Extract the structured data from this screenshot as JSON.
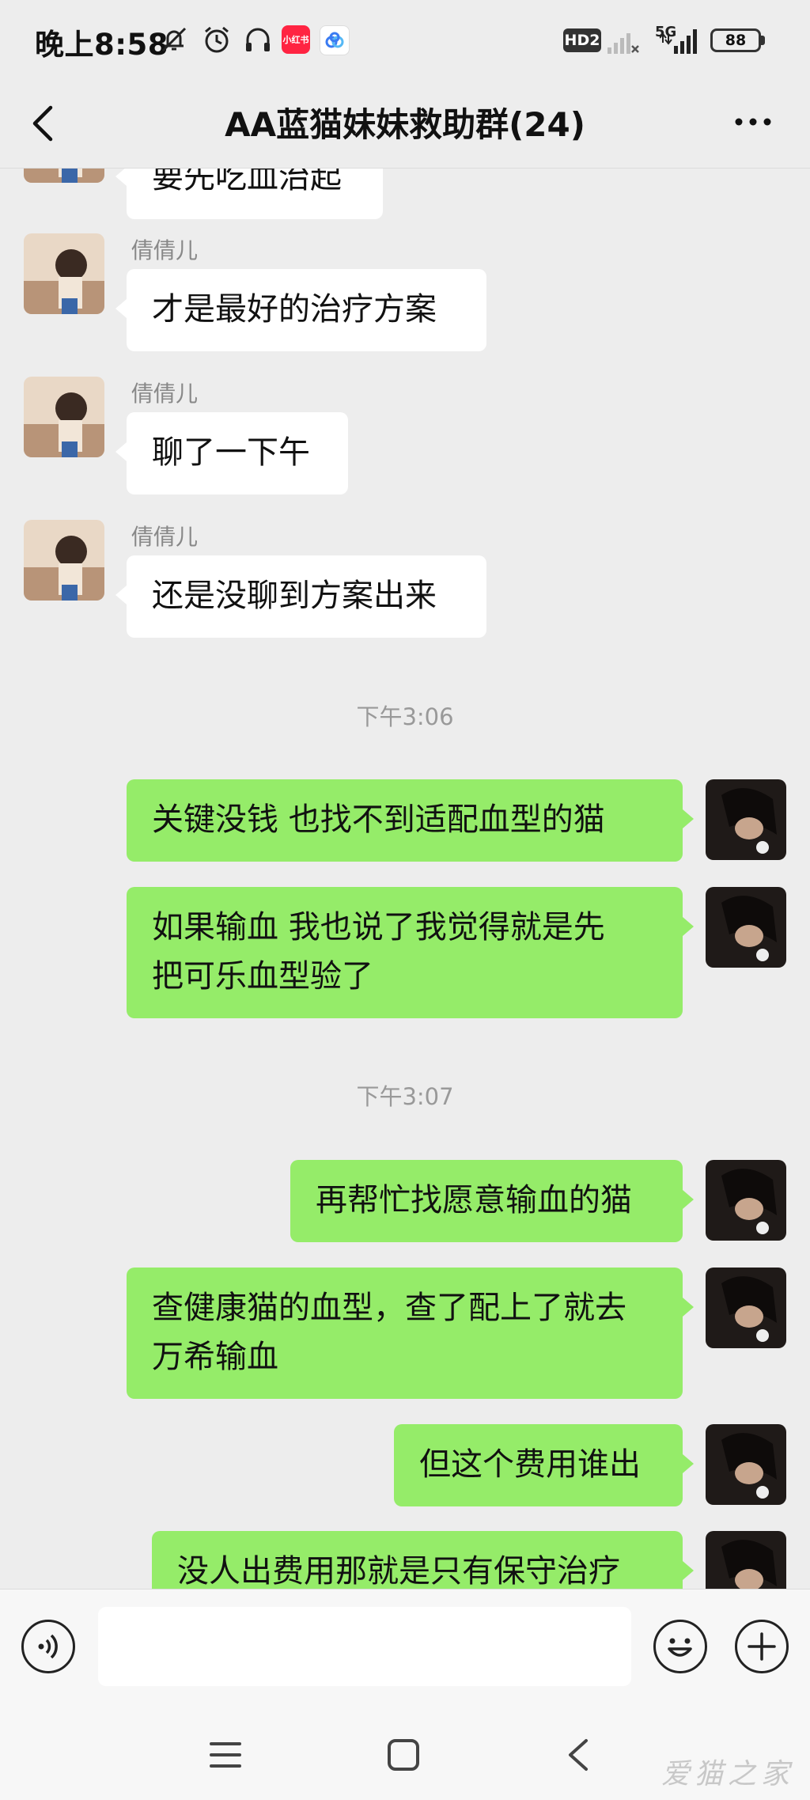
{
  "status_bar": {
    "time": "晚上8:58",
    "app_icon_1_label": "小红书",
    "network_badge": "HD2",
    "cell_label": "5G",
    "battery": "88"
  },
  "nav": {
    "title": "AA蓝猫妹妹救助群(24)"
  },
  "messages": [
    {
      "type": "in",
      "sender": "",
      "text": "要先吃血治起"
    },
    {
      "type": "in",
      "sender": "倩倩儿",
      "text": "才是最好的治疗方案"
    },
    {
      "type": "in",
      "sender": "倩倩儿",
      "text": "聊了一下午"
    },
    {
      "type": "in",
      "sender": "倩倩儿",
      "text": "还是没聊到方案出来"
    },
    {
      "type": "time",
      "text": "下午3:06"
    },
    {
      "type": "out",
      "lines": [
        "关键没钱 也找不到适配血型的猫"
      ]
    },
    {
      "type": "out",
      "lines": [
        "如果输血 我也说了我觉得就是先",
        "把可乐血型验了"
      ]
    },
    {
      "type": "time",
      "text": "下午3:07"
    },
    {
      "type": "out",
      "lines": [
        "再帮忙找愿意输血的猫"
      ]
    },
    {
      "type": "out",
      "lines": [
        "查健康猫的血型，查了配上了就去",
        "万希输血"
      ]
    },
    {
      "type": "out",
      "lines": [
        "但这个费用谁出"
      ]
    },
    {
      "type": "out",
      "lines": [
        "没人出费用那就是只有保守治疗"
      ]
    }
  ],
  "watermark": "爱猫之家",
  "colors": {
    "background": "#EDEDED",
    "outgoing_bubble": "#95EC69",
    "incoming_bubble": "#FFFFFF",
    "timestamp": "#999999"
  }
}
